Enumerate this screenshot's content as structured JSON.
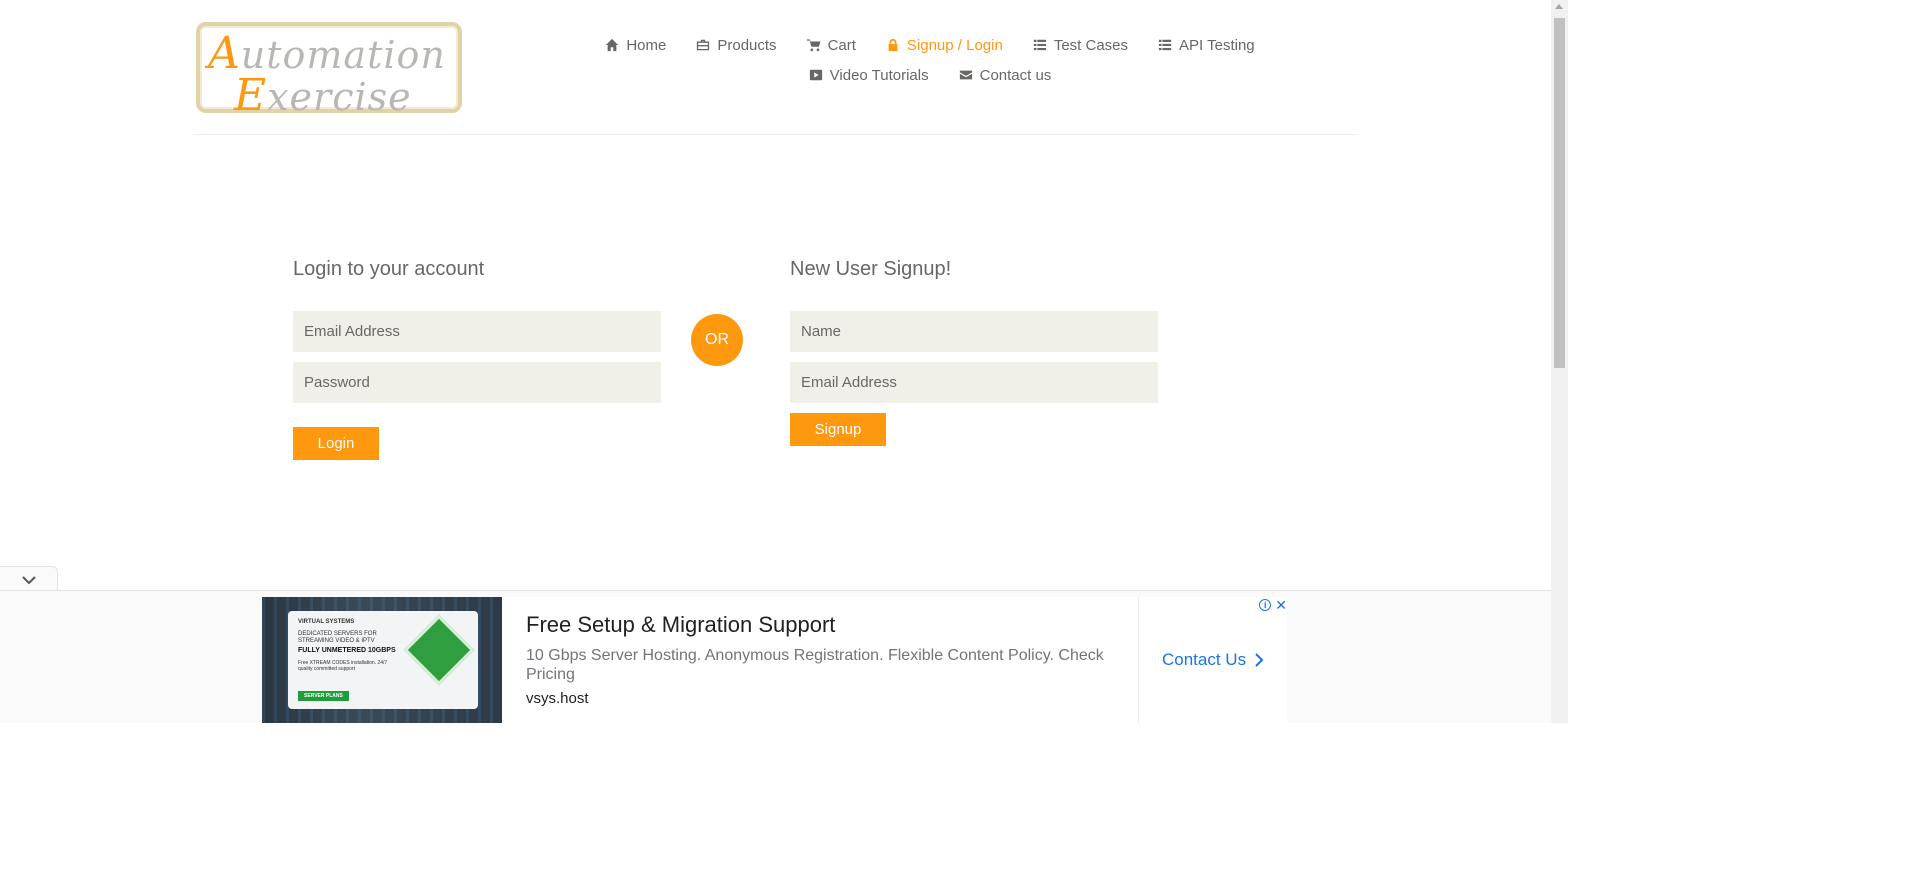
{
  "header": {
    "logo_line1_cap": "A",
    "logo_line1_rest": "utomation",
    "logo_line2_cap": "E",
    "logo_line2_rest": "xercise",
    "nav_row1": [
      {
        "label": "Home",
        "icon": "home-icon",
        "active": false
      },
      {
        "label": "Products",
        "icon": "briefcase-icon",
        "active": false
      },
      {
        "label": "Cart",
        "icon": "cart-icon",
        "active": false
      },
      {
        "label": "Signup / Login",
        "icon": "lock-icon",
        "active": true
      },
      {
        "label": "Test Cases",
        "icon": "list-icon",
        "active": false
      },
      {
        "label": "API Testing",
        "icon": "list-icon",
        "active": false
      }
    ],
    "nav_row2": [
      {
        "label": "Video Tutorials",
        "icon": "youtube-icon",
        "active": false
      },
      {
        "label": "Contact us",
        "icon": "envelope-icon",
        "active": false
      }
    ]
  },
  "login": {
    "title": "Login to your account",
    "email_placeholder": "Email Address",
    "email_value": "",
    "password_placeholder": "Password",
    "password_value": "",
    "button_label": "Login"
  },
  "divider": {
    "or_label": "OR"
  },
  "signup": {
    "title": "New User Signup!",
    "name_placeholder": "Name",
    "name_value": "",
    "email_placeholder": "Email Address",
    "email_value": "",
    "button_label": "Signup"
  },
  "ad": {
    "image_text1": "VIRTUAL SYSTEMS",
    "image_text2": "DEDICATED SERVERS FOR STREAMING VIDEO & IPTV",
    "image_text3": "FULLY UNMETERED 10GBPS",
    "image_text4": "Free XTREAM CODES installation. 24/7 quality committed support",
    "image_button": "SERVER PLANS",
    "headline": "Free Setup & Migration Support",
    "description": "10 Gbps Server Hosting. Anonymous Registration. Flexible Content Policy. Check Pricing",
    "domain": "vsys.host",
    "cta": "Contact Us"
  },
  "colors": {
    "accent": "#fe980f",
    "input_bg": "#f0f0e9",
    "text": "#696763",
    "ad_link": "#1a73e8"
  }
}
